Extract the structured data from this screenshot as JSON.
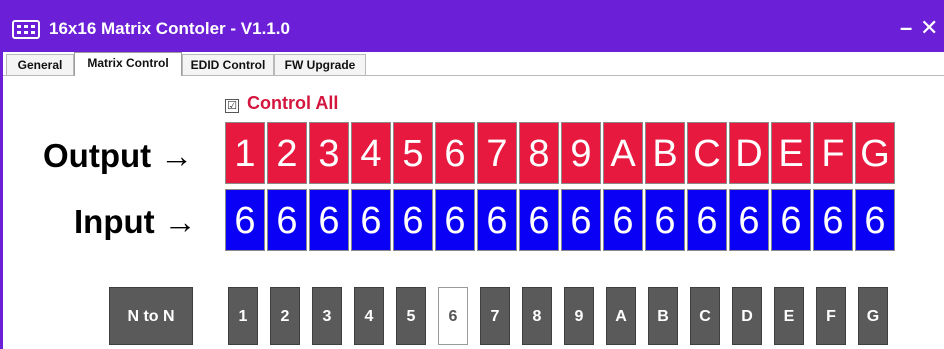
{
  "window": {
    "title": "16x16 Matrix Contoler - V1.1.0",
    "minimize_glyph": "–",
    "close_glyph": "✕",
    "accent": "#6b1fd6"
  },
  "tabs": [
    {
      "label": "General",
      "active": false
    },
    {
      "label": "Matrix Control",
      "active": true
    },
    {
      "label": "EDID Control",
      "active": false
    },
    {
      "label": "FW Upgrade",
      "active": false
    }
  ],
  "control_all": {
    "label": "Control All",
    "checked": true,
    "checkbox_glyph": "☑"
  },
  "matrix": {
    "output_label": "Output →",
    "input_label": "Input →",
    "outputs": [
      "1",
      "2",
      "3",
      "4",
      "5",
      "6",
      "7",
      "8",
      "9",
      "A",
      "B",
      "C",
      "D",
      "E",
      "F",
      "G"
    ],
    "inputs": [
      "6",
      "6",
      "6",
      "6",
      "6",
      "6",
      "6",
      "6",
      "6",
      "6",
      "6",
      "6",
      "6",
      "6",
      "6",
      "6"
    ],
    "output_color": "#e8193f",
    "input_color": "#0a00f5"
  },
  "input_selector": {
    "n_to_n_label": "N to N",
    "buttons": [
      "1",
      "2",
      "3",
      "4",
      "5",
      "6",
      "7",
      "8",
      "9",
      "A",
      "B",
      "C",
      "D",
      "E",
      "F",
      "G"
    ],
    "selected": "6"
  }
}
